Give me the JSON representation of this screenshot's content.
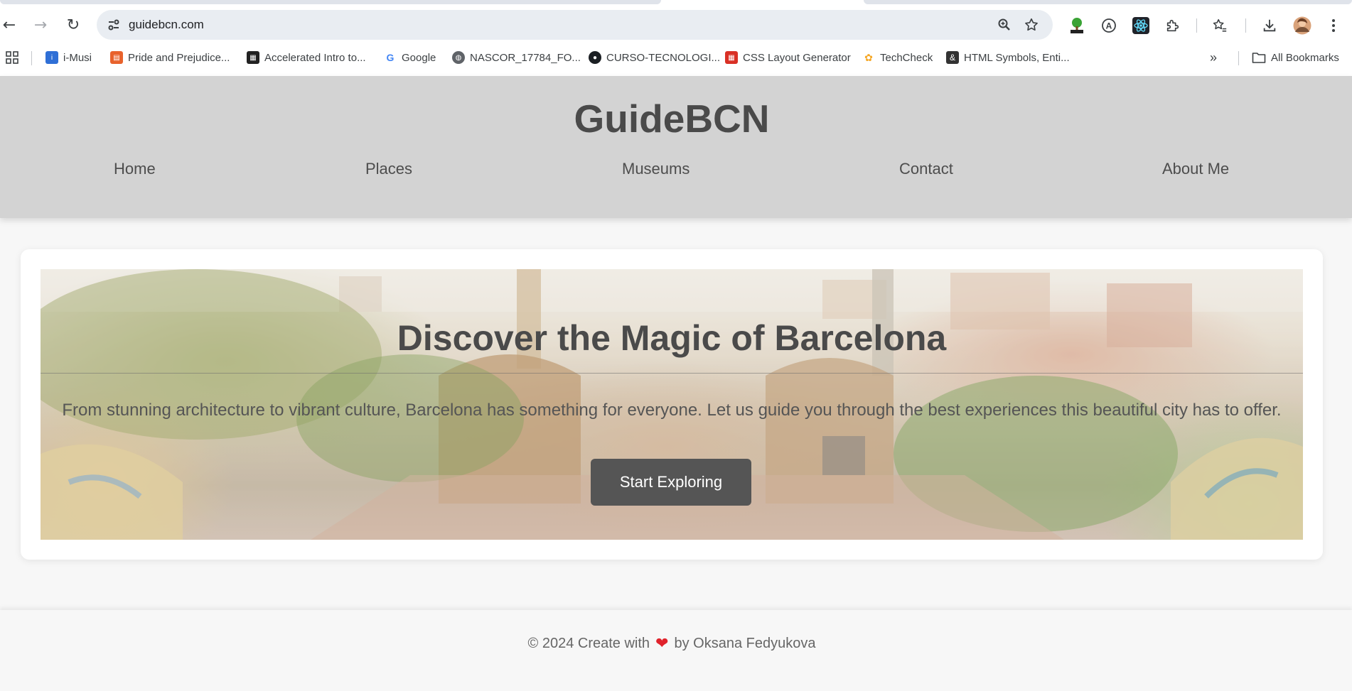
{
  "browser": {
    "url": "guidebcn.com",
    "icons": {
      "back": "arrow-left-icon",
      "forward": "arrow-right-icon",
      "reload": "reload-icon",
      "site_info": "tune-icon",
      "zoom": "zoom-icon",
      "bookmark_star": "star-icon"
    },
    "bookmarks": [
      {
        "label": "i-Musi",
        "icon": "imusi-icon",
        "color": "#2f6fd6"
      },
      {
        "label": "Pride and Prejudice...",
        "icon": "book-icon",
        "color": "#e8622c"
      },
      {
        "label": "Accelerated Intro to...",
        "icon": "cs50-icon",
        "color": "#222222"
      },
      {
        "label": "Google",
        "icon": "google-icon",
        "color": "#4285f4"
      },
      {
        "label": "NASCOR_17784_FO...",
        "icon": "globe-icon",
        "color": "#5f6368"
      },
      {
        "label": "CURSO-TECNOLOGI...",
        "icon": "github-icon",
        "color": "#1b1f23"
      },
      {
        "label": "CSS Layout Generator",
        "icon": "grid-icon",
        "color": "#d93025"
      },
      {
        "label": "TechCheck",
        "icon": "nbc-icon",
        "color": "#f5a623"
      },
      {
        "label": "HTML Symbols, Enti...",
        "icon": "ampersand-icon",
        "color": "#333333"
      }
    ],
    "all_bookmarks_label": "All Bookmarks"
  },
  "site": {
    "title": "GuideBCN",
    "nav": [
      "Home",
      "Places",
      "Museums",
      "Contact",
      "About Me"
    ],
    "hero": {
      "title": "Discover the Magic of Barcelona",
      "text": "From stunning architecture to vibrant culture, Barcelona has something for everyone. Let us guide you through the best experiences this beautiful city has to offer.",
      "button": "Start Exploring"
    },
    "footer": {
      "prefix": "© 2024 Create with",
      "suffix": "by Oksana Fedyukova"
    }
  },
  "colors": {
    "header_bg": "#d3d3d3",
    "button_bg": "#555555",
    "heart": "#e0232c"
  }
}
